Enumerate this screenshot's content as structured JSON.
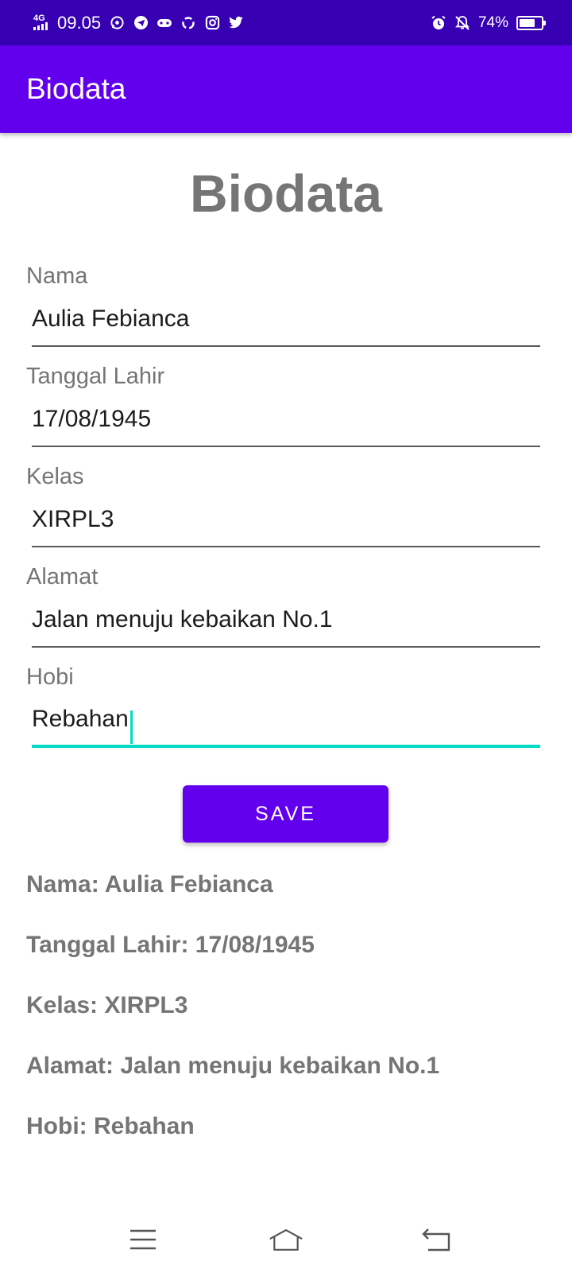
{
  "status_bar": {
    "network": "4G",
    "time": "09.05",
    "notification_icons": [
      "whatsapp-icon",
      "telegram-icon",
      "game-controller-icon",
      "sync-icon",
      "instagram-icon",
      "twitter-icon"
    ],
    "battery": "74%",
    "battery_level": 0.74
  },
  "app_bar": {
    "title": "Biodata"
  },
  "page": {
    "heading": "Biodata"
  },
  "form": {
    "nama": {
      "label": "Nama",
      "value": "Aulia Febianca"
    },
    "tanggal_lahir": {
      "label": "Tanggal Lahir",
      "value": "17/08/1945"
    },
    "kelas": {
      "label": "Kelas",
      "value": "XIRPL3"
    },
    "alamat": {
      "label": "Alamat",
      "value": "Jalan menuju kebaikan No.1"
    },
    "hobi": {
      "label": "Hobi",
      "value": "Rebahan"
    }
  },
  "save_button": {
    "label": "SAVE"
  },
  "results": {
    "nama": "Nama: Aulia Febianca",
    "tanggal_lahir": "Tanggal Lahir: 17/08/1945",
    "kelas": "Kelas: XIRPL3",
    "alamat": "Alamat: Jalan menuju kebaikan No.1",
    "hobi": "Hobi: Rebahan"
  },
  "nav_bar": {
    "buttons": [
      "menu-icon",
      "home-icon",
      "back-icon"
    ]
  },
  "colors": {
    "status_bar": "#3700b3",
    "primary": "#6200ee",
    "accent": "#03dac5",
    "label_gray": "#757575"
  }
}
